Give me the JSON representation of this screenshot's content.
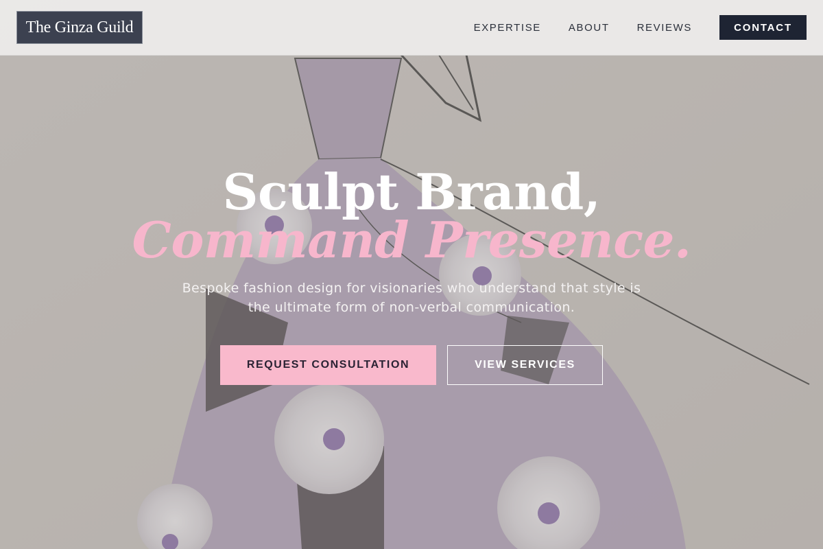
{
  "brand": {
    "logo_text": "The Ginza Guild"
  },
  "nav": {
    "links": [
      "EXPERTISE",
      "ABOUT",
      "REVIEWS"
    ],
    "contact_label": "CONTACT"
  },
  "hero": {
    "headline_line1": "Sculpt Brand,",
    "headline_line2": "Command Presence.",
    "subtitle": "Bespoke fashion design for visionaries who understand that style is the ultimate form of non-verbal communication.",
    "primary_cta": "REQUEST CONSULTATION",
    "secondary_cta": "VIEW SERVICES",
    "background_image": "gown-sketch-illustration"
  },
  "colors": {
    "accent_pink": "#f9b9cc",
    "headline_pink": "#f7b6cc",
    "navy": "#1e2433",
    "logo_bg": "#3c4150"
  }
}
